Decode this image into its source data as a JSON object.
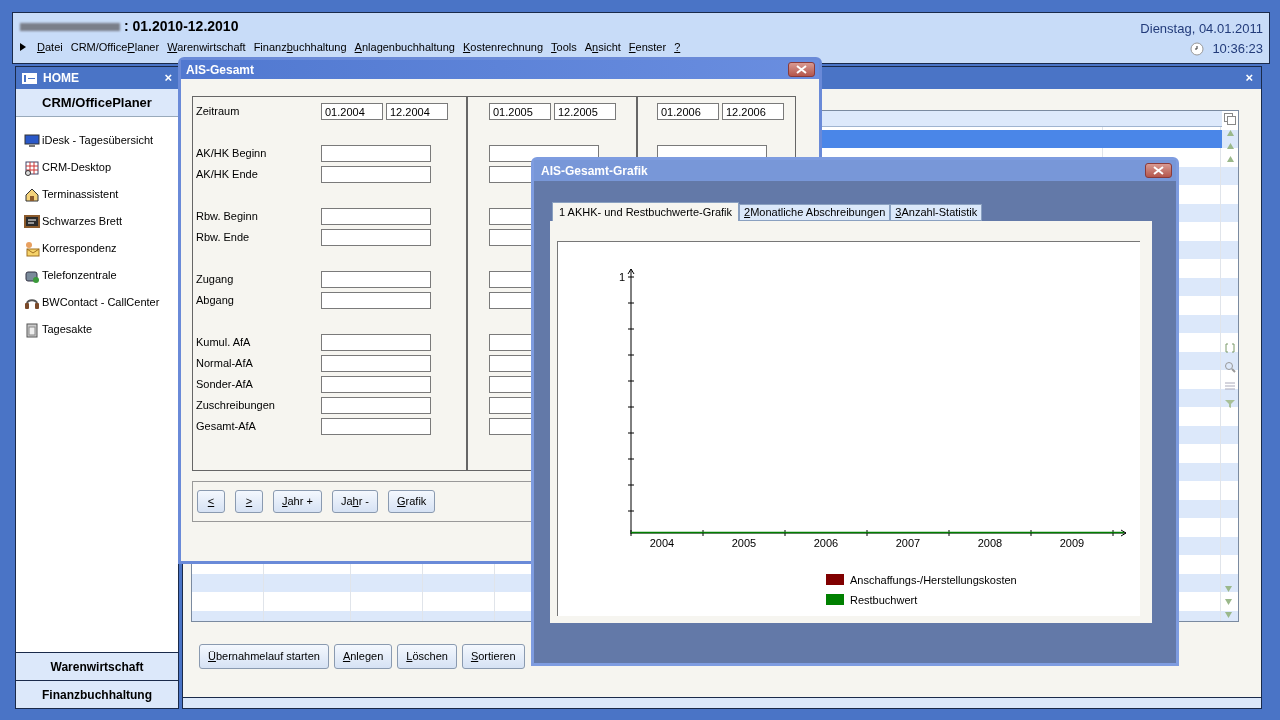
{
  "app": {
    "title": ": 01.2010-12.2010",
    "date": "Dienstag, 04.01.2011",
    "time": "10:36:23"
  },
  "menu": [
    {
      "key": "D",
      "post": "atei"
    },
    {
      "pre": "CRM/Office",
      "key": "P",
      "post": "laner"
    },
    {
      "key": "W",
      "post": "arenwirtschaft"
    },
    {
      "pre": "Finanz",
      "key": "b",
      "post": "uchhaltung"
    },
    {
      "key": "A",
      "post": "nlagenbuchhaltung"
    },
    {
      "key": "K",
      "post": "ostenrechnung"
    },
    {
      "key": "T",
      "post": "ools"
    },
    {
      "pre": "A",
      "key": "n",
      "post": "sicht"
    },
    {
      "key": "F",
      "post": "enster"
    },
    {
      "key": "?"
    }
  ],
  "sidebar": {
    "title": "HOME",
    "section": "CRM/OfficePlaner",
    "close": "×",
    "items": [
      {
        "label": "iDesk - Tagesübersicht"
      },
      {
        "label": "CRM-Desktop"
      },
      {
        "label": "Terminassistent"
      },
      {
        "label": "Schwarzes Brett"
      },
      {
        "label": "Korrespondenz"
      },
      {
        "label": "Telefonzentrale"
      },
      {
        "label": "BWContact - CallCenter"
      },
      {
        "label": "Tagesakte"
      }
    ],
    "bottom": [
      "Warenwirtschaft",
      "Finanzbuchhaltung"
    ]
  },
  "main": {
    "close": "×",
    "buttons": [
      {
        "key": "Ü",
        "post": "bernahmelauf starten"
      },
      {
        "key": "A",
        "post": "nlegen"
      },
      {
        "key": "L",
        "post": "öschen"
      },
      {
        "key": "S",
        "post": "ortieren"
      }
    ]
  },
  "ais": {
    "title": "AIS-Gesamt",
    "period_label": "Zeitraum",
    "periods": [
      {
        "from": "01.2004",
        "to": "12.2004"
      },
      {
        "from": "01.2005",
        "to": "12.2005"
      },
      {
        "from": "01.2006",
        "to": "12.2006"
      }
    ],
    "groups": [
      [
        "AK/HK Beginn",
        "AK/HK Ende"
      ],
      [
        "Rbw. Beginn",
        "Rbw. Ende"
      ],
      [
        "Zugang",
        "Abgang"
      ],
      [
        "Kumul. AfA",
        "Normal-AfA",
        "Sonder-AfA",
        "Zuschreibungen",
        "Gesamt-AfA"
      ]
    ],
    "buttons": [
      {
        "key": "<"
      },
      {
        "key": ">"
      },
      {
        "key": "J",
        "post": "ahr +"
      },
      {
        "pre": "Ja",
        "key": "h",
        "post": "r -"
      },
      {
        "key": "G",
        "post": "rafik"
      }
    ]
  },
  "grafik": {
    "title": "AIS-Gesamt-Grafik",
    "tabs": [
      {
        "label": {
          "post": "1 AKHK- und Restbuchwerte-Grafik"
        },
        "selected": true
      },
      {
        "label": {
          "key": "2",
          "post": " Monatliche Abschreibungen"
        },
        "selected": false
      },
      {
        "label": {
          "key": "3",
          "post": " Anzahl-Statistik"
        },
        "selected": false
      }
    ],
    "chart": {
      "x_labels": [
        "2004",
        "2005",
        "2006",
        "2007",
        "2008",
        "2009"
      ],
      "y_label": "1",
      "legend": [
        {
          "name": "Anschaffungs-/Herstellungskosten",
          "color": "#800000"
        },
        {
          "name": "Restbuchwert",
          "color": "#008000"
        }
      ]
    }
  }
}
